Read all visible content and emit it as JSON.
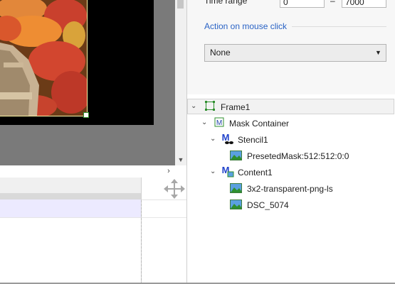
{
  "properties": {
    "time_range_label": "Time range",
    "time_from": "0",
    "time_dash": "–",
    "time_to": "7000",
    "action_section_label": "Action on mouse click",
    "action_selected": "None"
  },
  "tree": {
    "frame": "Frame1",
    "mask_container": "Mask Container",
    "stencil": "Stencil1",
    "preset_mask": "PresetedMask:512:512:0:0",
    "content": "Content1",
    "image1": "3x2-transparent-png-ls",
    "image2": "DSC_5074"
  },
  "icons": {
    "frame": "frame-outline-icon",
    "mask": "mask-m-icon",
    "stencil": "stencil-m-icon",
    "content": "content-m-icon",
    "image": "image-thumbnail-icon",
    "move": "move-arrows-icon"
  },
  "colors": {
    "accent": "#2a63c5",
    "selection_row": "#eceaff",
    "frame_icon": "#2f8f2f"
  }
}
